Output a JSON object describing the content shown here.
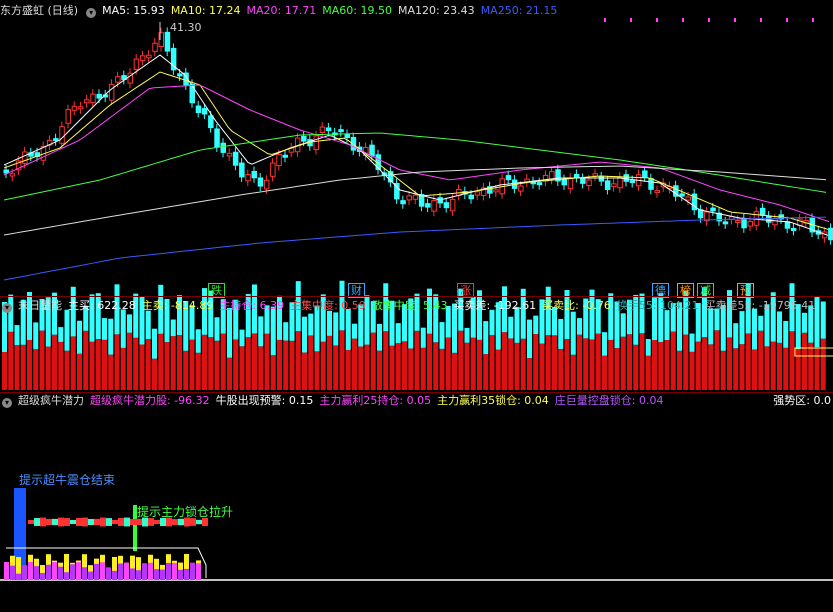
{
  "main_header": {
    "title": "东方盛虹 (日线)",
    "items": [
      {
        "label": "MA5: 15.93",
        "color": "#ffffff"
      },
      {
        "label": "MA10: 17.24",
        "color": "#ffff55"
      },
      {
        "label": "MA20: 17.71",
        "color": "#ff44ff"
      },
      {
        "label": "MA60: 19.50",
        "color": "#44ff44"
      },
      {
        "label": "MA120: 23.43",
        "color": "#dddddd"
      },
      {
        "label": "MA250: 21.15",
        "color": "#3a5bff"
      }
    ]
  },
  "price_chart": {
    "peak_label": "41.30",
    "tags": [
      {
        "text": "跌",
        "color": "#33dd33"
      },
      {
        "text": "财",
        "color": "#33aaff"
      },
      {
        "text": "涨",
        "color": "#ff3333"
      },
      {
        "text": "德",
        "color": "#33aaff"
      },
      {
        "text": "榜",
        "color": "#ff9900"
      },
      {
        "text": "减",
        "color": "#33dd33"
      },
      {
        "text": "预",
        "color": "#ff9900"
      }
    ]
  },
  "volume_header": {
    "title": "末日量能",
    "items": [
      {
        "label": "主买: 622.28",
        "color": "#ffffff"
      },
      {
        "label": "主卖: -814.89",
        "color": "#ffff55"
      },
      {
        "label": "主持仓: 6.39",
        "color": "#ff44ff"
      },
      {
        "label": "主集中度: 0.59",
        "color": "#ff4444"
      },
      {
        "label": "散集中度: 5.43",
        "color": "#44ff44"
      },
      {
        "label": "买卖差: -192.61",
        "color": "#ffffff"
      },
      {
        "label": "买卖比: -0.76",
        "color": "#ffff55"
      },
      {
        "label": "换手55: 104.21",
        "color": "#33aaaa"
      },
      {
        "label": "买卖差55: -19795.41",
        "color": "#bbbbbb"
      }
    ]
  },
  "potential_header": {
    "title": "超级疯牛潜力",
    "items": [
      {
        "label": "超级疯牛潜力股: -96.32",
        "color": "#ff44ff"
      },
      {
        "label": "牛股出现预警: 0.15",
        "color": "#ffffff"
      },
      {
        "label": "主力赢利25持仓: 0.05",
        "color": "#ff44ff"
      },
      {
        "label": "主力赢利35锁仓: 0.04",
        "color": "#ffff55"
      },
      {
        "label": "庄巨量控盘锁仓: 0.04",
        "color": "#bb55ff"
      }
    ],
    "right_label": "强势区: 0.0"
  },
  "annotations": {
    "shake_end": "提示超牛震仓结束",
    "lock_rise": "提示主力锁仓拉升"
  },
  "colors": {
    "up": "#ff3333",
    "down": "#33ffff",
    "separator": "#7a0000"
  }
}
